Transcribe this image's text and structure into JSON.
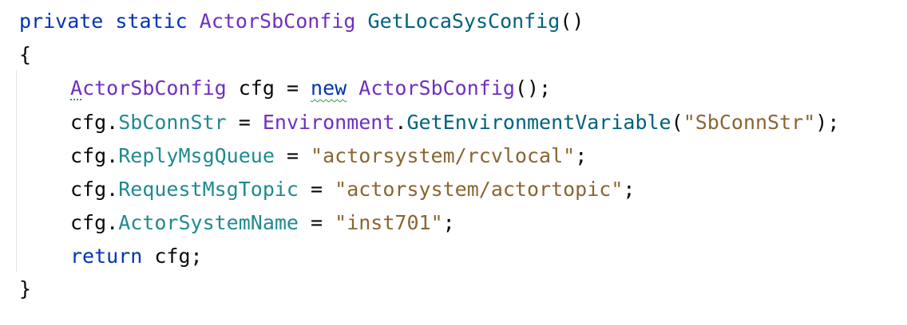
{
  "code": {
    "l1": {
      "t1": "private static ",
      "t2": "ActorSbConfig",
      "t3": " ",
      "t4": "GetLocaSysConfig",
      "t5": "()"
    },
    "l2": {
      "t1": "{"
    },
    "l3": {
      "t1a": "A",
      "t1b": "ctorSbConfig",
      "t2": " cfg = ",
      "t3": "new",
      "t4": " ",
      "t5": "ActorSbConfig",
      "t6": "();"
    },
    "l4": {
      "t1": "cfg.",
      "t2": "SbConnStr",
      "t3": " = ",
      "t4": "Environment",
      "t5": ".",
      "t6": "GetEnvironmentVariable",
      "t7": "(",
      "t8": "\"SbConnStr\"",
      "t9": ");"
    },
    "l5": {
      "t1": "cfg.",
      "t2": "ReplyMsgQueue",
      "t3": " = ",
      "t4": "\"actorsystem/rcvlocal\"",
      "t5": ";"
    },
    "l6": {
      "t1": "cfg.",
      "t2": "RequestMsgTopic",
      "t3": " = ",
      "t4": "\"actorsystem/actortopic\"",
      "t5": ";"
    },
    "l7": {
      "t1": "cfg.",
      "t2": "ActorSystemName",
      "t3": " = ",
      "t4": "\"inst701\"",
      "t5": ";"
    },
    "l8": {
      "t1": "return",
      "t2": " cfg;"
    },
    "l9": {
      "t1": "}"
    }
  },
  "colors": {
    "keyword": "#0033b3",
    "type": "#6f2fc2",
    "method": "#00627a",
    "property": "#1f8a8f",
    "string": "#8a6532",
    "plain": "#080808",
    "inspection_hint": "#2e9c42"
  }
}
